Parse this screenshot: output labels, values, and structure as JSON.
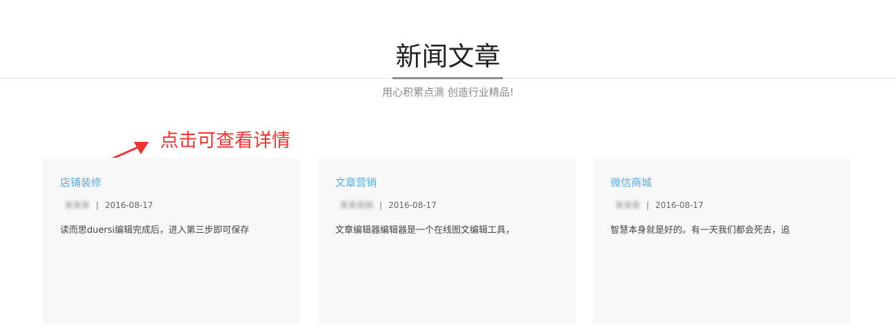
{
  "section": {
    "title": "新闻文章",
    "subtitle": "用心积累点滴 创造行业精品!"
  },
  "annotation": {
    "text": "点击可查看详情",
    "color": "#ee3333"
  },
  "articles": [
    {
      "title": "店铺装修",
      "author": "某某某",
      "separator": "|",
      "date": "2016-08-17",
      "excerpt": "读而思duersi编辑完成后，进入第三步即可保存"
    },
    {
      "title": "文章营销",
      "author": "某某营销",
      "separator": "|",
      "date": "2016-08-17",
      "excerpt": "文章编辑器编辑器是一个在线图文编辑工具，"
    },
    {
      "title": "微信商城",
      "author": "某某章",
      "separator": "|",
      "date": "2016-08-17",
      "excerpt": "智慧本身就是好的。有一天我们都会死去，追"
    }
  ],
  "colors": {
    "accent": "#5aaedf",
    "card_bg": "#f8f8f8",
    "title_underline": "#8d8d8d"
  }
}
